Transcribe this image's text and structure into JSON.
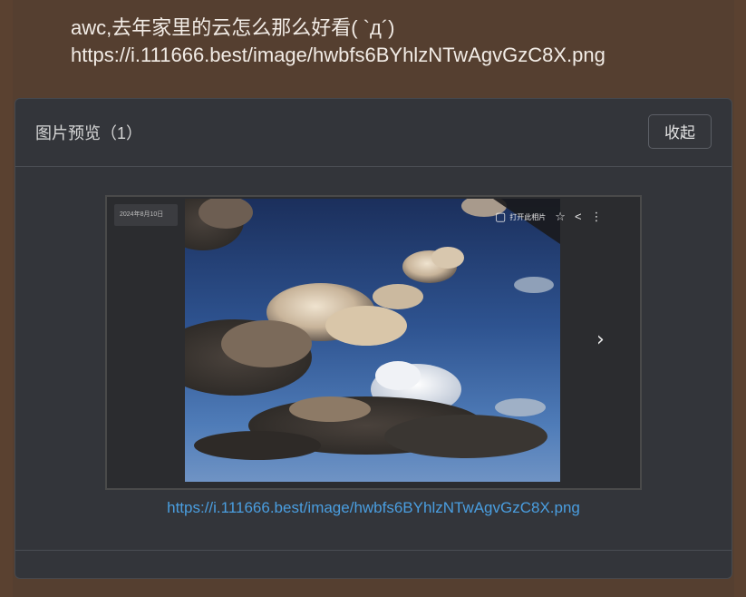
{
  "message": {
    "line1": "awc,去年家里的云怎么那么好看( `д´)",
    "line2": "https://i.111666.best/image/hwbfs6BYhlzNTwAgvGzC8X.png"
  },
  "preview": {
    "title": "图片预览（1）",
    "collapse_label": "收起",
    "date_label": "2024年8月10日",
    "open_label": "打开此相片",
    "link_text": "https://i.111666.best/image/hwbfs6BYhlzNTwAgvGzC8X.png",
    "icons": [
      "photo-icon",
      "star-icon",
      "share-icon",
      "more-icon",
      "chevron-right-icon"
    ]
  }
}
